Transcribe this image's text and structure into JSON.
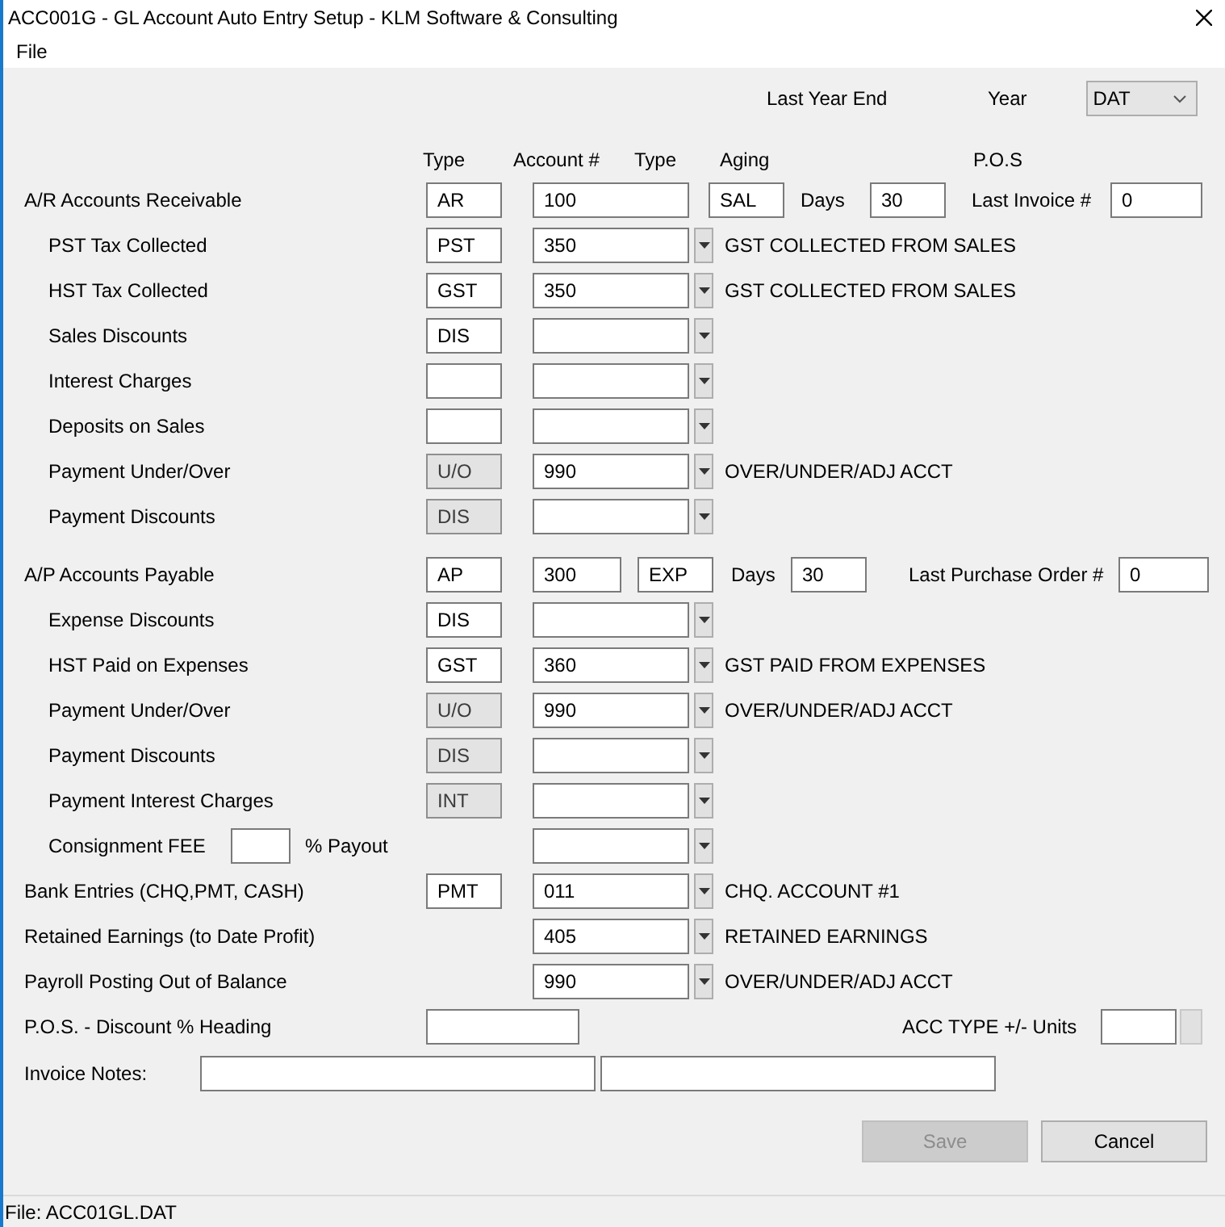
{
  "window": {
    "title": "ACC001G - GL Account Auto Entry Setup - KLM Software & Consulting"
  },
  "menu": [
    "File"
  ],
  "year_end": {
    "label": "Last Year End",
    "year_label": "Year",
    "year": "DAT"
  },
  "column_headers": [
    "Type",
    "Account #",
    "Type",
    "Aging",
    "P.O.S"
  ],
  "rows": [
    {
      "kind": "ledger",
      "label": "A/R Accounts Receivable",
      "type": "AR",
      "account": "100",
      "aging": "SAL",
      "days_label": "Days",
      "days": "30",
      "last_label": "Last Invoice #",
      "last_value": "0",
      "children": [
        {
          "kind": "account",
          "label": "PST Tax Collected",
          "type": "PST",
          "type_disabled": false,
          "account": "350",
          "description": "GST COLLECTED FROM SALES"
        },
        {
          "kind": "account",
          "label": "HST Tax Collected",
          "type": "GST",
          "type_disabled": false,
          "account": "350",
          "description": "GST COLLECTED FROM SALES"
        },
        {
          "kind": "account",
          "label": "Sales Discounts",
          "type": "DIS",
          "type_disabled": false
        },
        {
          "kind": "account",
          "label": "Interest Charges",
          "type_disabled": false
        },
        {
          "kind": "account",
          "label": "Deposits on Sales",
          "type_disabled": false
        },
        {
          "kind": "account",
          "label": "Payment Under/Over",
          "type": "U/O",
          "type_disabled": true,
          "account": "990",
          "description": "OVER/UNDER/ADJ ACCT"
        },
        {
          "kind": "account",
          "label": "Payment Discounts",
          "type": "DIS",
          "type_disabled": true
        }
      ]
    },
    {
      "kind": "ledger",
      "label": "A/P Accounts Payable",
      "type": "AP",
      "account": "300",
      "aging": "EXP",
      "days_label": "Days",
      "days": "30",
      "last_label": "Last Purchase Order #",
      "last_value": "0",
      "children": [
        {
          "kind": "account",
          "label": "Expense Discounts",
          "type": "DIS",
          "type_disabled": false
        },
        {
          "kind": "account",
          "label": "HST Paid on Expenses",
          "type": "GST",
          "type_disabled": false,
          "account": "360",
          "description": "GST PAID FROM EXPENSES"
        },
        {
          "kind": "account",
          "label": "Payment Under/Over",
          "type": "U/O",
          "type_disabled": true,
          "account": "990",
          "description": "OVER/UNDER/ADJ ACCT"
        },
        {
          "kind": "account",
          "label": "Payment Discounts",
          "type": "DIS",
          "type_disabled": true
        },
        {
          "kind": "account",
          "label": "Payment Interest Charges",
          "type": "INT",
          "type_disabled": true
        },
        {
          "kind": "consignment",
          "label": "Consignment FEE",
          "payout_label": "% Payout"
        }
      ]
    },
    {
      "kind": "account",
      "label": "Bank Entries (CHQ,PMT, CASH)",
      "type": "PMT",
      "type_disabled": false,
      "account": "011",
      "description": "CHQ. ACCOUNT #1"
    },
    {
      "kind": "account-only",
      "label": "Retained Earnings (to Date Profit)",
      "account": "405",
      "description": "RETAINED EARNINGS"
    },
    {
      "kind": "account-only",
      "label": "Payroll Posting Out of Balance",
      "account": "990",
      "description": "OVER/UNDER/ADJ ACCT"
    }
  ],
  "pos": {
    "label": "P.O.S. - Discount % Heading",
    "units_label": "ACC TYPE +/- Units"
  },
  "invoice_notes": {
    "label": "Invoice Notes:"
  },
  "buttons": [
    {
      "label": "Save",
      "disabled": true
    },
    {
      "label": "Cancel",
      "disabled": false
    }
  ],
  "status_bar": "File: ACC01GL.DAT"
}
